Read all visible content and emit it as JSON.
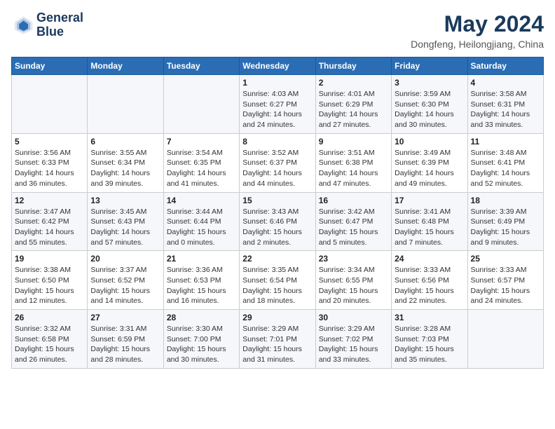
{
  "header": {
    "logo": {
      "line1": "General",
      "line2": "Blue"
    },
    "title": "May 2024",
    "location": "Dongfeng, Heilongjiang, China"
  },
  "days_header": [
    "Sunday",
    "Monday",
    "Tuesday",
    "Wednesday",
    "Thursday",
    "Friday",
    "Saturday"
  ],
  "weeks": [
    [
      {
        "day": "",
        "info": ""
      },
      {
        "day": "",
        "info": ""
      },
      {
        "day": "",
        "info": ""
      },
      {
        "day": "1",
        "info": "Sunrise: 4:03 AM\nSunset: 6:27 PM\nDaylight: 14 hours\nand 24 minutes."
      },
      {
        "day": "2",
        "info": "Sunrise: 4:01 AM\nSunset: 6:29 PM\nDaylight: 14 hours\nand 27 minutes."
      },
      {
        "day": "3",
        "info": "Sunrise: 3:59 AM\nSunset: 6:30 PM\nDaylight: 14 hours\nand 30 minutes."
      },
      {
        "day": "4",
        "info": "Sunrise: 3:58 AM\nSunset: 6:31 PM\nDaylight: 14 hours\nand 33 minutes."
      }
    ],
    [
      {
        "day": "5",
        "info": "Sunrise: 3:56 AM\nSunset: 6:33 PM\nDaylight: 14 hours\nand 36 minutes."
      },
      {
        "day": "6",
        "info": "Sunrise: 3:55 AM\nSunset: 6:34 PM\nDaylight: 14 hours\nand 39 minutes."
      },
      {
        "day": "7",
        "info": "Sunrise: 3:54 AM\nSunset: 6:35 PM\nDaylight: 14 hours\nand 41 minutes."
      },
      {
        "day": "8",
        "info": "Sunrise: 3:52 AM\nSunset: 6:37 PM\nDaylight: 14 hours\nand 44 minutes."
      },
      {
        "day": "9",
        "info": "Sunrise: 3:51 AM\nSunset: 6:38 PM\nDaylight: 14 hours\nand 47 minutes."
      },
      {
        "day": "10",
        "info": "Sunrise: 3:49 AM\nSunset: 6:39 PM\nDaylight: 14 hours\nand 49 minutes."
      },
      {
        "day": "11",
        "info": "Sunrise: 3:48 AM\nSunset: 6:41 PM\nDaylight: 14 hours\nand 52 minutes."
      }
    ],
    [
      {
        "day": "12",
        "info": "Sunrise: 3:47 AM\nSunset: 6:42 PM\nDaylight: 14 hours\nand 55 minutes."
      },
      {
        "day": "13",
        "info": "Sunrise: 3:45 AM\nSunset: 6:43 PM\nDaylight: 14 hours\nand 57 minutes."
      },
      {
        "day": "14",
        "info": "Sunrise: 3:44 AM\nSunset: 6:44 PM\nDaylight: 15 hours\nand 0 minutes."
      },
      {
        "day": "15",
        "info": "Sunrise: 3:43 AM\nSunset: 6:46 PM\nDaylight: 15 hours\nand 2 minutes."
      },
      {
        "day": "16",
        "info": "Sunrise: 3:42 AM\nSunset: 6:47 PM\nDaylight: 15 hours\nand 5 minutes."
      },
      {
        "day": "17",
        "info": "Sunrise: 3:41 AM\nSunset: 6:48 PM\nDaylight: 15 hours\nand 7 minutes."
      },
      {
        "day": "18",
        "info": "Sunrise: 3:39 AM\nSunset: 6:49 PM\nDaylight: 15 hours\nand 9 minutes."
      }
    ],
    [
      {
        "day": "19",
        "info": "Sunrise: 3:38 AM\nSunset: 6:50 PM\nDaylight: 15 hours\nand 12 minutes."
      },
      {
        "day": "20",
        "info": "Sunrise: 3:37 AM\nSunset: 6:52 PM\nDaylight: 15 hours\nand 14 minutes."
      },
      {
        "day": "21",
        "info": "Sunrise: 3:36 AM\nSunset: 6:53 PM\nDaylight: 15 hours\nand 16 minutes."
      },
      {
        "day": "22",
        "info": "Sunrise: 3:35 AM\nSunset: 6:54 PM\nDaylight: 15 hours\nand 18 minutes."
      },
      {
        "day": "23",
        "info": "Sunrise: 3:34 AM\nSunset: 6:55 PM\nDaylight: 15 hours\nand 20 minutes."
      },
      {
        "day": "24",
        "info": "Sunrise: 3:33 AM\nSunset: 6:56 PM\nDaylight: 15 hours\nand 22 minutes."
      },
      {
        "day": "25",
        "info": "Sunrise: 3:33 AM\nSunset: 6:57 PM\nDaylight: 15 hours\nand 24 minutes."
      }
    ],
    [
      {
        "day": "26",
        "info": "Sunrise: 3:32 AM\nSunset: 6:58 PM\nDaylight: 15 hours\nand 26 minutes."
      },
      {
        "day": "27",
        "info": "Sunrise: 3:31 AM\nSunset: 6:59 PM\nDaylight: 15 hours\nand 28 minutes."
      },
      {
        "day": "28",
        "info": "Sunrise: 3:30 AM\nSunset: 7:00 PM\nDaylight: 15 hours\nand 30 minutes."
      },
      {
        "day": "29",
        "info": "Sunrise: 3:29 AM\nSunset: 7:01 PM\nDaylight: 15 hours\nand 31 minutes."
      },
      {
        "day": "30",
        "info": "Sunrise: 3:29 AM\nSunset: 7:02 PM\nDaylight: 15 hours\nand 33 minutes."
      },
      {
        "day": "31",
        "info": "Sunrise: 3:28 AM\nSunset: 7:03 PM\nDaylight: 15 hours\nand 35 minutes."
      },
      {
        "day": "",
        "info": ""
      }
    ]
  ]
}
